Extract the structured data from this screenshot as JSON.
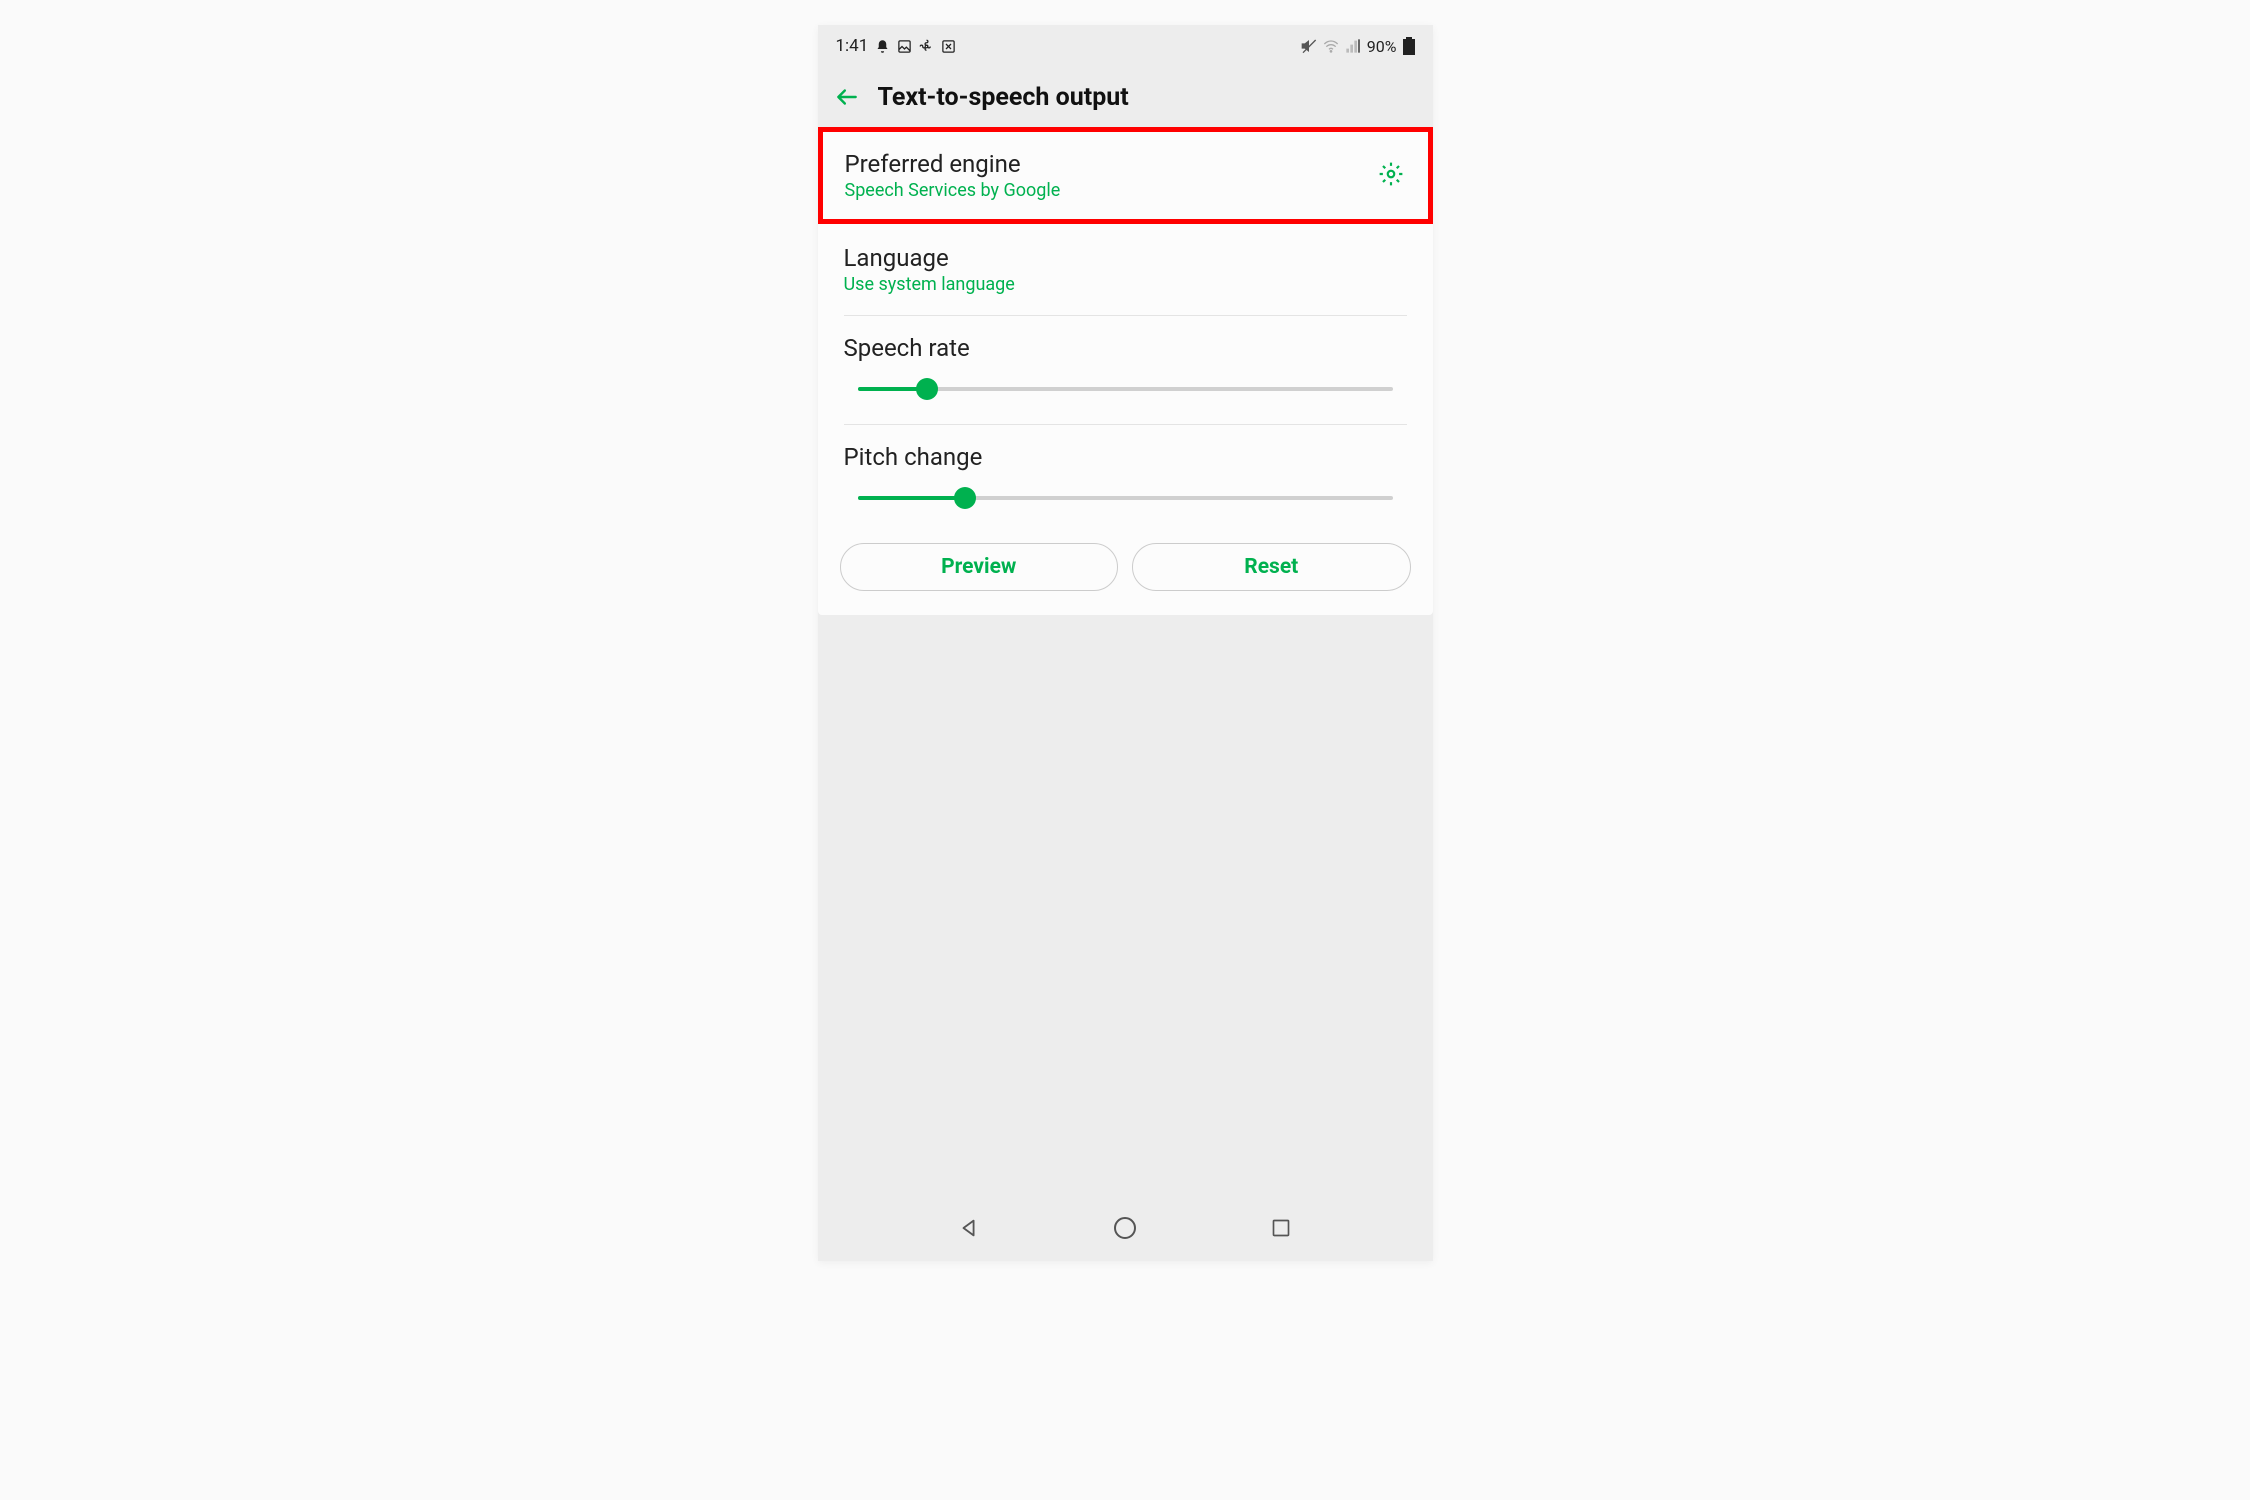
{
  "status": {
    "time": "1:41",
    "battery": "90%"
  },
  "header": {
    "title": "Text-to-speech output"
  },
  "settings": {
    "engine": {
      "label": "Preferred engine",
      "value": "Speech Services by Google"
    },
    "language": {
      "label": "Language",
      "value": "Use system language"
    },
    "speech_rate": {
      "label": "Speech rate",
      "value_percent": 13
    },
    "pitch": {
      "label": "Pitch change",
      "value_percent": 20
    }
  },
  "buttons": {
    "preview": "Preview",
    "reset": "Reset"
  }
}
